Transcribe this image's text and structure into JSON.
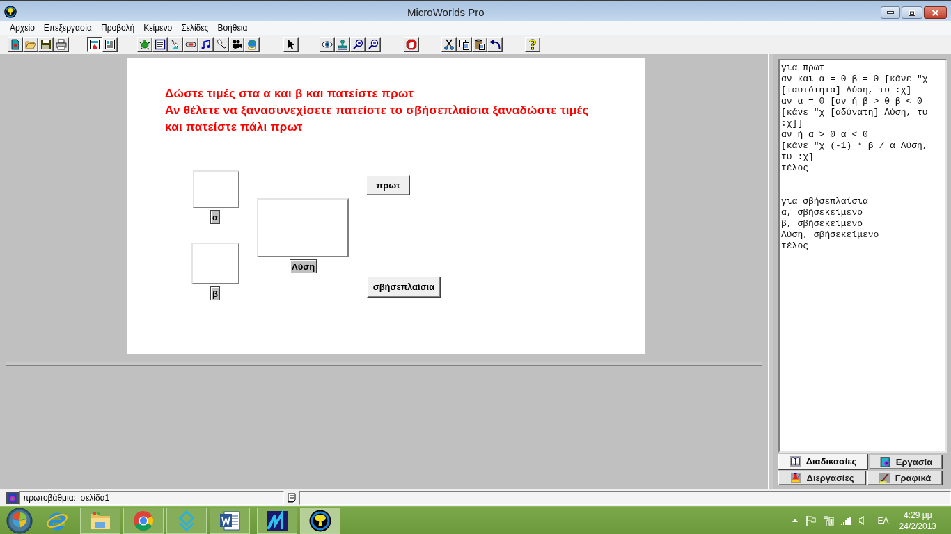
{
  "window": {
    "title": "MicroWorlds Pro"
  },
  "menu": [
    "Αρχείο",
    "Επεξεργασία",
    "Προβολή",
    "Κείμενο",
    "Σελίδες",
    "Βοήθεια"
  ],
  "toolbar": {
    "groups": [
      [
        {
          "selected": false
        },
        {
          "selected": false
        },
        {
          "selected": false
        },
        {
          "selected": false
        }
      ],
      [
        {
          "selected": true
        },
        {
          "selected": false
        }
      ],
      [
        {
          "selected": false
        },
        {
          "selected": false
        },
        {
          "selected": false
        },
        {
          "selected": false
        },
        {
          "selected": false
        },
        {
          "selected": false
        },
        {
          "selected": false
        },
        {
          "selected": false
        }
      ],
      [
        {
          "selected": false
        }
      ],
      [
        {
          "selected": false
        },
        {
          "selected": false
        },
        {
          "selected": false
        },
        {
          "selected": false
        }
      ],
      [
        {
          "selected": false
        }
      ],
      [
        {
          "selected": false
        },
        {
          "selected": false
        },
        {
          "selected": false
        },
        {
          "selected": false
        }
      ],
      [
        {
          "selected": false
        }
      ]
    ]
  },
  "page": {
    "instructions": [
      "Δώστε τιμές στα α και β και πατείστε πρωτ",
      "Αν θέλετε να ξανασυνεχίσετε πατείστε το σβήσεπλαίσια ξαναδώστε τιμές",
      "και πατείστε πάλι πρωτ"
    ],
    "widgets": [
      {
        "kind": "textbox",
        "label": "α"
      },
      {
        "kind": "button",
        "label": "πρωτ"
      },
      {
        "kind": "textbox",
        "label": "Λύση"
      },
      {
        "kind": "textbox",
        "label": "β"
      },
      {
        "kind": "button",
        "label": "σβήσεπλαίσια"
      }
    ]
  },
  "procedures": {
    "blocks": [
      {
        "lines": [
          "για πρωτ",
          "αν και α = 0 β = 0 [κάνε \"χ",
          "[ταυτότητα] Λύση, τυ :χ]",
          "αν α = 0 [αν ή β > 0 β < 0",
          "[κάνε \"χ [αδύνατη] Λύση, τυ",
          ":χ]]",
          "αν ή α > 0 α < 0",
          "[κάνε \"χ (-1) * β / α Λύση,",
          "τυ :χ]",
          "τέλος"
        ]
      },
      {
        "lines": [
          "για σβήσεπλαίσια",
          "α, σβήσεκείμενο",
          "β, σβήσεκείμενο",
          "Λύση, σβήσεκείμενο",
          "τέλος"
        ]
      }
    ]
  },
  "tabs": [
    {
      "label": "Διαδικασίες",
      "selected": true
    },
    {
      "label": "Εργασία",
      "selected": false
    },
    {
      "label": "Διεργασίες",
      "selected": false
    },
    {
      "label": "Γραφικά",
      "selected": false
    }
  ],
  "status_bar": {
    "page": "πρωτοβάθμια:  σελίδα1"
  },
  "taskbar": {
    "apps": [
      {
        "running": false,
        "selected": false
      },
      {
        "running": true,
        "selected": false
      },
      {
        "running": true,
        "selected": false
      },
      {
        "running": true,
        "selected": false
      },
      {
        "running": true,
        "selected": false
      },
      {
        "running": true,
        "selected": false
      },
      {
        "running": true,
        "selected": true
      }
    ],
    "language": "ΕΛ",
    "time": "4:29 μμ",
    "date": "24/2/2013"
  }
}
